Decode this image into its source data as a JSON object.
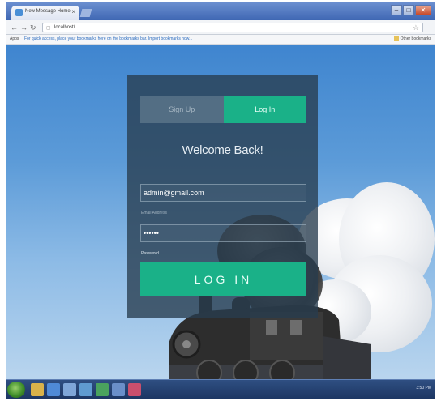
{
  "browser": {
    "tab_title": "New Message Home",
    "tab_close": "×",
    "url": "localhost/",
    "bookmarks_apps": "Apps",
    "bookmarks_text": "For quick access, place your bookmarks here on the bookmarks bar. Import bookmarks now...",
    "bookmarks_other": "Other bookmarks"
  },
  "login": {
    "tab_signup": "Sign Up",
    "tab_login": "Log In",
    "heading": "Welcome Back!",
    "email_value": "admin@gmail.com",
    "email_label": "Email Address",
    "password_value": "••••••",
    "password_label": "Password",
    "submit_label": "LOG IN"
  },
  "taskbar": {
    "clock": "3:50 PM"
  },
  "colors": {
    "accent": "#1ab188",
    "panel": "#283c4e",
    "sky": "#3f85cf"
  },
  "icons": [
    "favicon-icon",
    "back-icon",
    "forward-icon",
    "reload-icon",
    "star-icon",
    "windows-start-icon"
  ]
}
